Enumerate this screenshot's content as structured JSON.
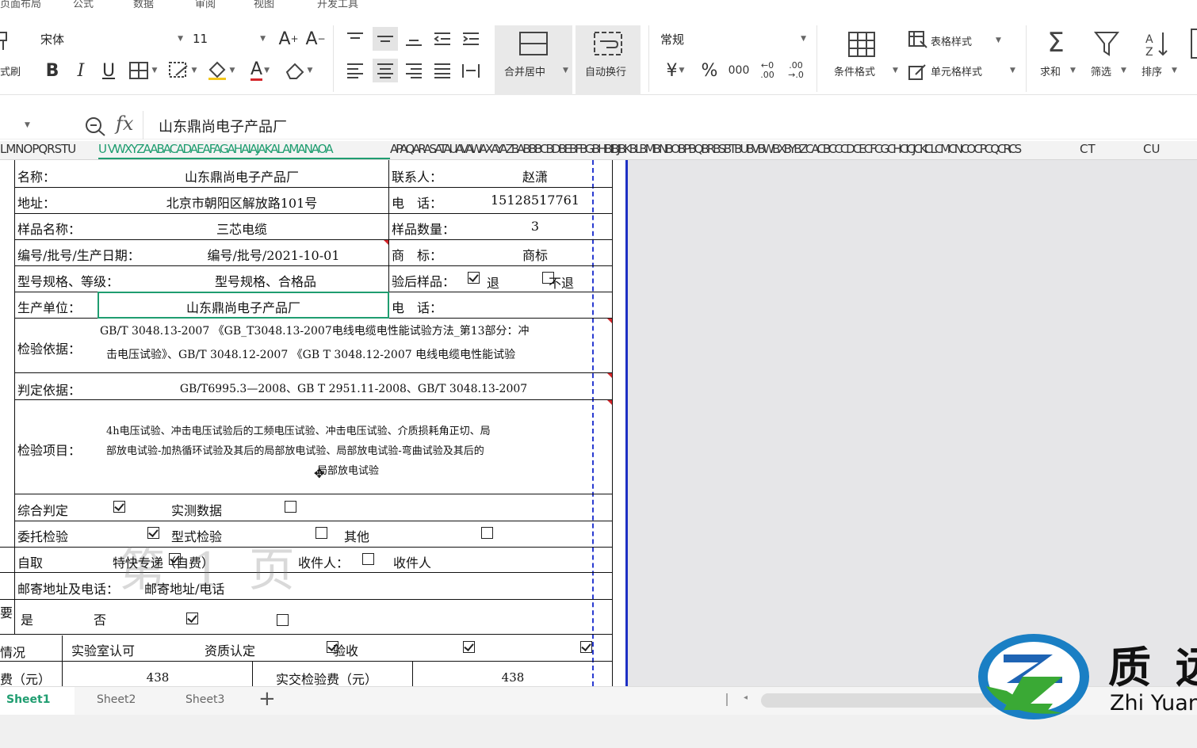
{
  "menu": {
    "tabs": [
      "页面布局",
      "公式",
      "数据",
      "审阅",
      "视图",
      "开发工具"
    ]
  },
  "ribbon": {
    "font_name": "宋体",
    "font_size": "11",
    "left_partial_label": "式刷",
    "merge_label": "合并居中",
    "wrap_label": "自动换行",
    "number_format": "常规",
    "currency_symbol": "¥",
    "percent_symbol": "%",
    "thousands_symbol": "000",
    "dec_inc_label": "←0 .00",
    "dec_dec_label": ".00 →.0",
    "cond_format_label": "条件格式",
    "table_style_label": "表格样式",
    "cell_style_label": "单元格样式",
    "sum_label": "求和",
    "filter_label": "筛选",
    "sort_label": "排序",
    "accent_color": "#1a73e8"
  },
  "formula_bar": {
    "fx_label": "fx",
    "content": "山东鼎尚电子产品厂"
  },
  "columns": {
    "left_letters": "LMNOPQRSTU",
    "selected_letters": "U VWXYZAABACADAEAFAGAHAIAJAKALAMANAOA",
    "right_letters": "APAQARASATAUAVAWAXAYAZBABBBCBDBEBFBGBHBIBJBKBLBMBNBOBPBQBRBSBTBUBVBWBXBYBZCACBCCCDCECFCGCHCICJCKCLCMCNCOCPCQCRCS",
    "ct": "CT",
    "cu": "CU"
  },
  "form": {
    "name_label": "名称：",
    "name_value": "山东鼎尚电子产品厂",
    "contact_label": "联系人：",
    "contact_value": "赵潇",
    "address_label": "地址：",
    "address_value": "北京市朝阳区解放路101号",
    "phone_label": "电　话：",
    "phone_value": "15128517761",
    "sample_name_label": "样品名称：",
    "sample_name_value": "三芯电缆",
    "sample_qty_label": "样品数量：",
    "sample_qty_value": "3",
    "batch_label": "编号/批号/生产日期：",
    "batch_value": "编号/批号/2021-10-01",
    "brand_label": "商　标：",
    "brand_value": "商标",
    "model_label": "型号规格、等级：",
    "model_value": "型号规格、合格品",
    "after_test_label": "验后样品：",
    "return_label": "退",
    "noreturn_label": "不退",
    "producer_label": "生产单位：",
    "producer_value": "山东鼎尚电子产品厂",
    "producer_phone_label": "电　话：",
    "basis_label": "检验依据：",
    "basis_line1": "GB/T 3048.13-2007 《GB_T3048.13-2007电线电缆电性能试验方法_第13部分：冲",
    "basis_line2": "击电压试验》、GB/T 3048.12-2007 《GB T 3048.12-2007 电线电缆电性能试验",
    "judge_label": "判定依据：",
    "judge_value": "GB/T6995.3—2008、GB T 2951.11-2008、GB/T 3048.13-2007",
    "items_label": "检验项目：",
    "items_line1": "4h电压试验、冲击电压试验后的工频电压试验、冲击电压试验、介质损耗角正切、局",
    "items_line2": "部放电试验-加热循环试验及其后的局部放电试验、局部放电试验-弯曲试验及其后的",
    "items_line3": "局部放电试验",
    "overall_label": "综合判定",
    "measured_label": "实测数据",
    "entrust_label": "委托检验",
    "type_label": "型式检验",
    "other_label": "其他",
    "self_pick_label": "自取",
    "express_label": "特快专递（自费）",
    "receiver_label": "收件人：",
    "receiver_value": "收件人",
    "mail_label": "邮寄地址及电话：",
    "mail_value": "邮寄地址/电话",
    "yes_label": "是",
    "no_label": "否",
    "side_label_1": "要",
    "side_label_2": "情况",
    "lab_label": "实验室认可",
    "qual_label": "资质认定",
    "accept_label": "验收",
    "fee_label": "费（元）",
    "fee_value": "438",
    "actual_fee_label": "实交检验费（元）",
    "actual_fee_value": "438",
    "watermark": "第 1 页"
  },
  "sheets": [
    "Sheet1",
    "Sheet2",
    "Sheet3"
  ],
  "active_sheet": "Sheet1",
  "logo": {
    "cn": "质 远",
    "en": "Zhi Yuan"
  }
}
